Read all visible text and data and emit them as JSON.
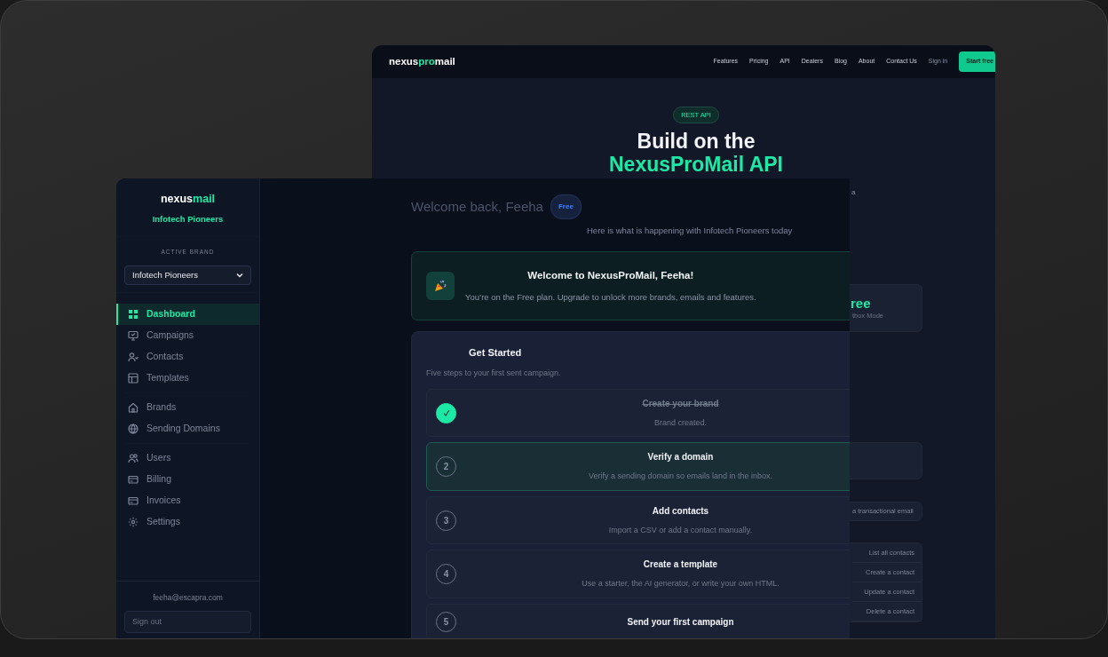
{
  "back_window": {
    "logo": {
      "part_1": "nexus",
      "part_2": "pro",
      "part_3": "mail"
    },
    "nav_links": [
      "Features",
      "Pricing",
      "API",
      "Dealers",
      "Blog",
      "About",
      "Contact Us"
    ],
    "sign_in": "Sign in",
    "cta": "Start free",
    "hero": {
      "badge": "REST API",
      "title_line_1": "Build on the",
      "title_line_2": "NexusProMail API"
    },
    "side_column": {
      "fragment": "a",
      "plan_value": "ree",
      "plan_caption": "tbox Mode",
      "endpoint": "a transactional email",
      "contact_endpoints": [
        "List all contacts",
        "Create a contact",
        "Update a contact",
        "Delete a contact"
      ]
    }
  },
  "app_window": {
    "sidebar": {
      "logo": {
        "part_1": "nexus",
        "part_2": "mail"
      },
      "brand": "Infotech Pioneers",
      "active_brand_label": "ACTIVE BRAND",
      "brand_select": "Infotech Pioneers",
      "nav_groups": [
        [
          {
            "label": "Dashboard",
            "selected": true
          },
          {
            "label": "Campaigns",
            "selected": false
          },
          {
            "label": "Contacts",
            "selected": false
          },
          {
            "label": "Templates",
            "selected": false
          }
        ],
        [
          {
            "label": "Brands",
            "selected": false
          },
          {
            "label": "Sending Domains",
            "selected": false
          }
        ],
        [
          {
            "label": "Users",
            "selected": false
          },
          {
            "label": "Billing",
            "selected": false
          },
          {
            "label": "Invoices",
            "selected": false
          },
          {
            "label": "Settings",
            "selected": false
          }
        ]
      ],
      "email": "feeha@escapra.com",
      "sign_out": "Sign out"
    },
    "main": {
      "title": "Welcome back, Feeha",
      "plan_badge": "Free",
      "subtitle": "Here is what is happening with Infotech Pioneers today",
      "welcome": {
        "title": "Welcome to NexusProMail, Feeha!",
        "text": "You’re on the Free plan. Upgrade to unlock more brands, emails and features."
      },
      "get_started": {
        "title": "Get Started",
        "subtitle": "Five steps to your first sent campaign.",
        "steps": [
          {
            "title": "Create your brand",
            "description": "Brand created.",
            "completed": true,
            "current": false
          },
          {
            "number": "2",
            "title": "Verify a domain",
            "description": "Verify a sending domain so emails land in the inbox.",
            "completed": false,
            "current": true
          },
          {
            "number": "3",
            "title": "Add contacts",
            "description": "Import a CSV or add a contact manually.",
            "completed": false,
            "current": false
          },
          {
            "number": "4",
            "title": "Create a template",
            "description": "Use a starter, the AI generator, or write your own HTML.",
            "completed": false,
            "current": false
          },
          {
            "number": "5",
            "title": "Send your first campaign",
            "completed": false,
            "current": false
          }
        ]
      }
    }
  }
}
